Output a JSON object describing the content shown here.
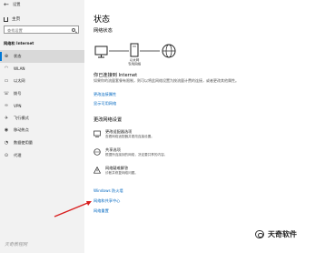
{
  "window": {
    "back_glyph": "←",
    "app_title": "设置"
  },
  "sidebar": {
    "home_label": "主页",
    "search_placeholder": "查找设置",
    "section_title": "网络和 Internet",
    "items": [
      {
        "label": "状态",
        "icon": "globe-icon",
        "glyph": "⊕",
        "active": true
      },
      {
        "label": "WLAN",
        "icon": "wifi-icon",
        "glyph": "◠"
      },
      {
        "label": "以太网",
        "icon": "ethernet-icon",
        "glyph": "▭"
      },
      {
        "label": "拨号",
        "icon": "dialup-icon",
        "glyph": "☏"
      },
      {
        "label": "VPN",
        "icon": "vpn-icon",
        "glyph": "∞"
      },
      {
        "label": "飞行模式",
        "icon": "airplane-icon",
        "glyph": "✈"
      },
      {
        "label": "移动热点",
        "icon": "hotspot-icon",
        "glyph": "◉"
      },
      {
        "label": "数据使用量",
        "icon": "data-usage-icon",
        "glyph": "◔"
      },
      {
        "label": "代理",
        "icon": "proxy-icon",
        "glyph": "⊙"
      }
    ],
    "watermark": "天奇教程网"
  },
  "main": {
    "title": "状态",
    "network_status_heading": "网络状态",
    "diagram_caption_1": "以太网",
    "diagram_caption_2": "专用网络",
    "status_main": "你已连接到 Internet",
    "status_sub": "如果你的流量套餐有限制，则可以将此网络设置为按流量计费的连接，或者更改其他属性。",
    "links_top": [
      "更改连接属性",
      "显示可用网络"
    ],
    "change_heading": "更改网络设置",
    "options": [
      {
        "icon": "adapter-icon",
        "title": "更改适配器选项",
        "desc": "查看网络适配器并更改连接设置。"
      },
      {
        "icon": "sharing-icon",
        "title": "共享选项",
        "desc": "根据所连接到的网络，决定要共享的内容。"
      },
      {
        "icon": "troubleshoot-icon",
        "title": "网络疑难解答",
        "desc": "诊断并修复网络问题。"
      }
    ],
    "links_bottom": [
      "Windows 防火墙",
      "网络和共享中心",
      "网络重置"
    ]
  },
  "watermark_right": "天奇软件",
  "colors": {
    "accent": "#0078d7",
    "link": "#0067c0",
    "arrow": "#d81e1e"
  }
}
